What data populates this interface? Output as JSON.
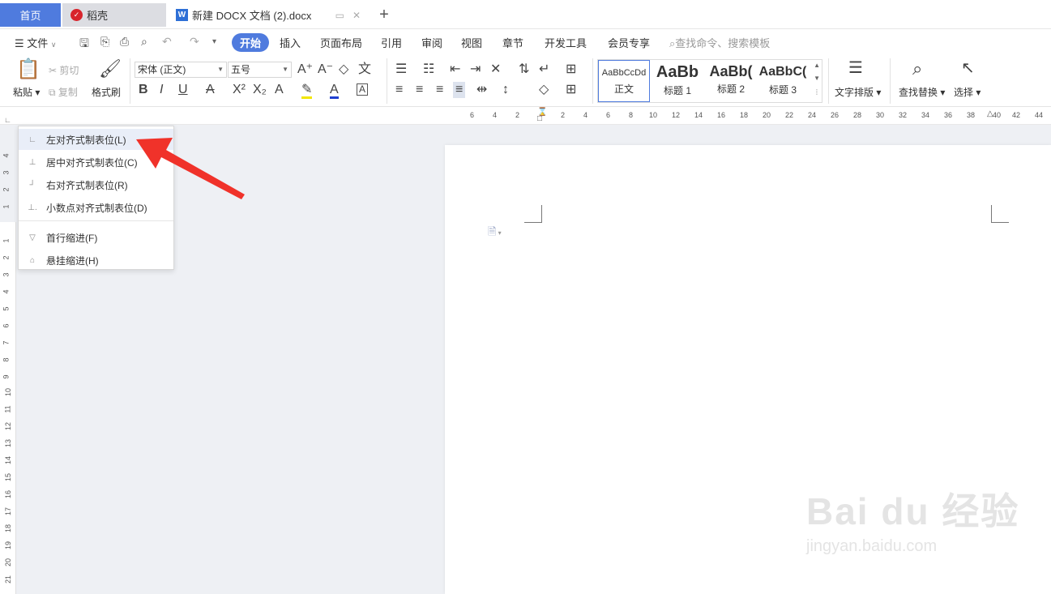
{
  "tabs": {
    "home": "首页",
    "daoke": "稻壳",
    "doc": "新建 DOCX 文档 (2).docx",
    "add": "+"
  },
  "menu": {
    "file": "文件",
    "items": [
      "开始",
      "插入",
      "页面布局",
      "引用",
      "审阅",
      "视图",
      "章节",
      "开发工具",
      "会员专享"
    ],
    "search": "查找命令、搜索模板"
  },
  "ribbon": {
    "paste": "粘贴",
    "cut": "剪切",
    "copy": "复制",
    "format_painter": "格式刷",
    "font_name": "宋体 (正文)",
    "font_size": "五号",
    "styles": [
      {
        "sample": "AaBbCcDd",
        "name": "正文"
      },
      {
        "sample": "AaBb",
        "name": "标题 1"
      },
      {
        "sample": "AaBb(",
        "name": "标题 2"
      },
      {
        "sample": "AaBbC(",
        "name": "标题 3"
      }
    ],
    "text_layout": "文字排版",
    "find_replace": "查找替换",
    "select": "选择"
  },
  "ruler": {
    "h_numbers": [
      "6",
      "4",
      "2",
      "2",
      "4",
      "6",
      "8",
      "10",
      "12",
      "14",
      "16",
      "18",
      "20",
      "22",
      "24",
      "26",
      "28",
      "30",
      "32",
      "34",
      "36",
      "38",
      "40",
      "42",
      "44"
    ],
    "v_numbers": [
      "4",
      "3",
      "2",
      "1",
      "1",
      "2",
      "3",
      "4",
      "5",
      "6",
      "7",
      "8",
      "9",
      "10",
      "11",
      "12",
      "13",
      "14",
      "15",
      "16",
      "17",
      "18",
      "19",
      "20",
      "21"
    ]
  },
  "dropdown": {
    "items": [
      "左对齐式制表位(L)",
      "居中对齐式制表位(C)",
      "右对齐式制表位(R)",
      "小数点对齐式制表位(D)",
      "首行缩进(F)",
      "悬挂缩进(H)"
    ]
  },
  "watermark": {
    "brand": "Bai du 经验",
    "url": "jingyan.baidu.com"
  },
  "colors": {
    "accent": "#4f7bde",
    "arrow": "#f0322a"
  }
}
